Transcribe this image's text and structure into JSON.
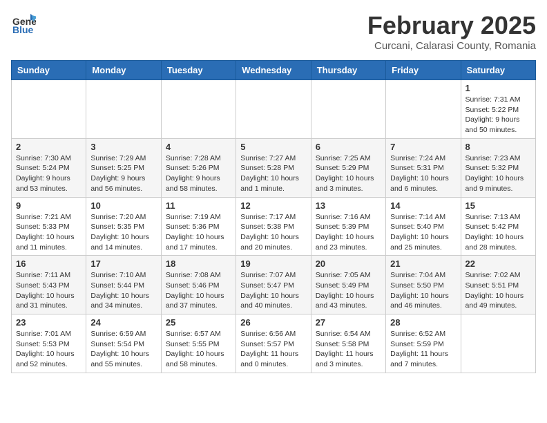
{
  "logo": {
    "general": "General",
    "blue": "Blue"
  },
  "header": {
    "month": "February 2025",
    "location": "Curcani, Calarasi County, Romania"
  },
  "weekdays": [
    "Sunday",
    "Monday",
    "Tuesday",
    "Wednesday",
    "Thursday",
    "Friday",
    "Saturday"
  ],
  "weeks": [
    [
      {
        "day": "",
        "info": ""
      },
      {
        "day": "",
        "info": ""
      },
      {
        "day": "",
        "info": ""
      },
      {
        "day": "",
        "info": ""
      },
      {
        "day": "",
        "info": ""
      },
      {
        "day": "",
        "info": ""
      },
      {
        "day": "1",
        "info": "Sunrise: 7:31 AM\nSunset: 5:22 PM\nDaylight: 9 hours and 50 minutes."
      }
    ],
    [
      {
        "day": "2",
        "info": "Sunrise: 7:30 AM\nSunset: 5:24 PM\nDaylight: 9 hours and 53 minutes."
      },
      {
        "day": "3",
        "info": "Sunrise: 7:29 AM\nSunset: 5:25 PM\nDaylight: 9 hours and 56 minutes."
      },
      {
        "day": "4",
        "info": "Sunrise: 7:28 AM\nSunset: 5:26 PM\nDaylight: 9 hours and 58 minutes."
      },
      {
        "day": "5",
        "info": "Sunrise: 7:27 AM\nSunset: 5:28 PM\nDaylight: 10 hours and 1 minute."
      },
      {
        "day": "6",
        "info": "Sunrise: 7:25 AM\nSunset: 5:29 PM\nDaylight: 10 hours and 3 minutes."
      },
      {
        "day": "7",
        "info": "Sunrise: 7:24 AM\nSunset: 5:31 PM\nDaylight: 10 hours and 6 minutes."
      },
      {
        "day": "8",
        "info": "Sunrise: 7:23 AM\nSunset: 5:32 PM\nDaylight: 10 hours and 9 minutes."
      }
    ],
    [
      {
        "day": "9",
        "info": "Sunrise: 7:21 AM\nSunset: 5:33 PM\nDaylight: 10 hours and 11 minutes."
      },
      {
        "day": "10",
        "info": "Sunrise: 7:20 AM\nSunset: 5:35 PM\nDaylight: 10 hours and 14 minutes."
      },
      {
        "day": "11",
        "info": "Sunrise: 7:19 AM\nSunset: 5:36 PM\nDaylight: 10 hours and 17 minutes."
      },
      {
        "day": "12",
        "info": "Sunrise: 7:17 AM\nSunset: 5:38 PM\nDaylight: 10 hours and 20 minutes."
      },
      {
        "day": "13",
        "info": "Sunrise: 7:16 AM\nSunset: 5:39 PM\nDaylight: 10 hours and 23 minutes."
      },
      {
        "day": "14",
        "info": "Sunrise: 7:14 AM\nSunset: 5:40 PM\nDaylight: 10 hours and 25 minutes."
      },
      {
        "day": "15",
        "info": "Sunrise: 7:13 AM\nSunset: 5:42 PM\nDaylight: 10 hours and 28 minutes."
      }
    ],
    [
      {
        "day": "16",
        "info": "Sunrise: 7:11 AM\nSunset: 5:43 PM\nDaylight: 10 hours and 31 minutes."
      },
      {
        "day": "17",
        "info": "Sunrise: 7:10 AM\nSunset: 5:44 PM\nDaylight: 10 hours and 34 minutes."
      },
      {
        "day": "18",
        "info": "Sunrise: 7:08 AM\nSunset: 5:46 PM\nDaylight: 10 hours and 37 minutes."
      },
      {
        "day": "19",
        "info": "Sunrise: 7:07 AM\nSunset: 5:47 PM\nDaylight: 10 hours and 40 minutes."
      },
      {
        "day": "20",
        "info": "Sunrise: 7:05 AM\nSunset: 5:49 PM\nDaylight: 10 hours and 43 minutes."
      },
      {
        "day": "21",
        "info": "Sunrise: 7:04 AM\nSunset: 5:50 PM\nDaylight: 10 hours and 46 minutes."
      },
      {
        "day": "22",
        "info": "Sunrise: 7:02 AM\nSunset: 5:51 PM\nDaylight: 10 hours and 49 minutes."
      }
    ],
    [
      {
        "day": "23",
        "info": "Sunrise: 7:01 AM\nSunset: 5:53 PM\nDaylight: 10 hours and 52 minutes."
      },
      {
        "day": "24",
        "info": "Sunrise: 6:59 AM\nSunset: 5:54 PM\nDaylight: 10 hours and 55 minutes."
      },
      {
        "day": "25",
        "info": "Sunrise: 6:57 AM\nSunset: 5:55 PM\nDaylight: 10 hours and 58 minutes."
      },
      {
        "day": "26",
        "info": "Sunrise: 6:56 AM\nSunset: 5:57 PM\nDaylight: 11 hours and 0 minutes."
      },
      {
        "day": "27",
        "info": "Sunrise: 6:54 AM\nSunset: 5:58 PM\nDaylight: 11 hours and 3 minutes."
      },
      {
        "day": "28",
        "info": "Sunrise: 6:52 AM\nSunset: 5:59 PM\nDaylight: 11 hours and 7 minutes."
      },
      {
        "day": "",
        "info": ""
      }
    ]
  ]
}
